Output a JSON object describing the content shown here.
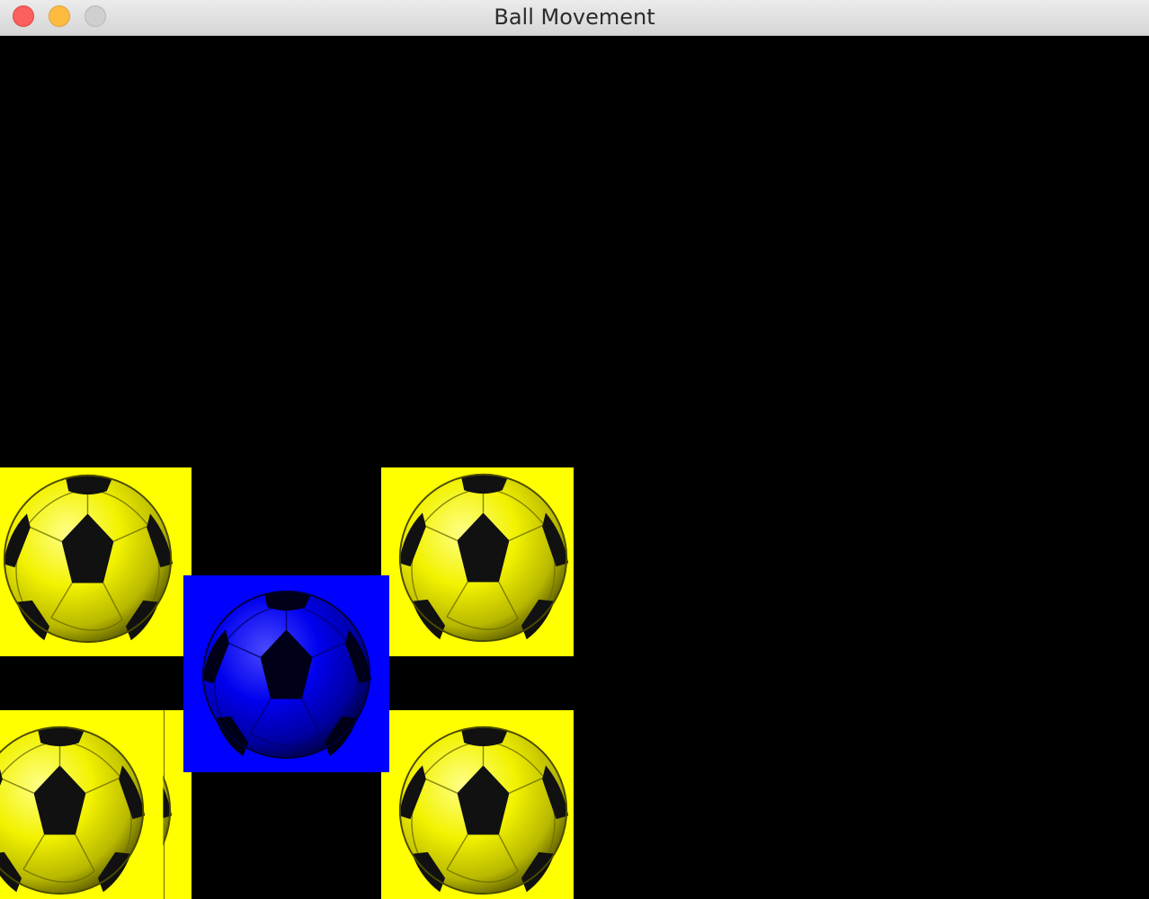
{
  "window": {
    "title": "Ball Movement",
    "controls": {
      "close": "close-button",
      "minimize": "minimize-button",
      "zoom": "zoom-button"
    }
  },
  "scene": {
    "background": "#000000",
    "balls": [
      {
        "name": "yellow-ball-top-left",
        "color": "#ffff00",
        "icon": "soccer-ball-icon"
      },
      {
        "name": "yellow-ball-top-right",
        "color": "#ffff00",
        "icon": "soccer-ball-icon"
      },
      {
        "name": "blue-ball-center",
        "color": "#0000ff",
        "icon": "soccer-ball-icon"
      },
      {
        "name": "yellow-ball-bottom-left",
        "color": "#ffff00",
        "icon": "soccer-ball-icon"
      },
      {
        "name": "yellow-ball-bottom-right",
        "color": "#ffff00",
        "icon": "soccer-ball-icon"
      }
    ]
  }
}
